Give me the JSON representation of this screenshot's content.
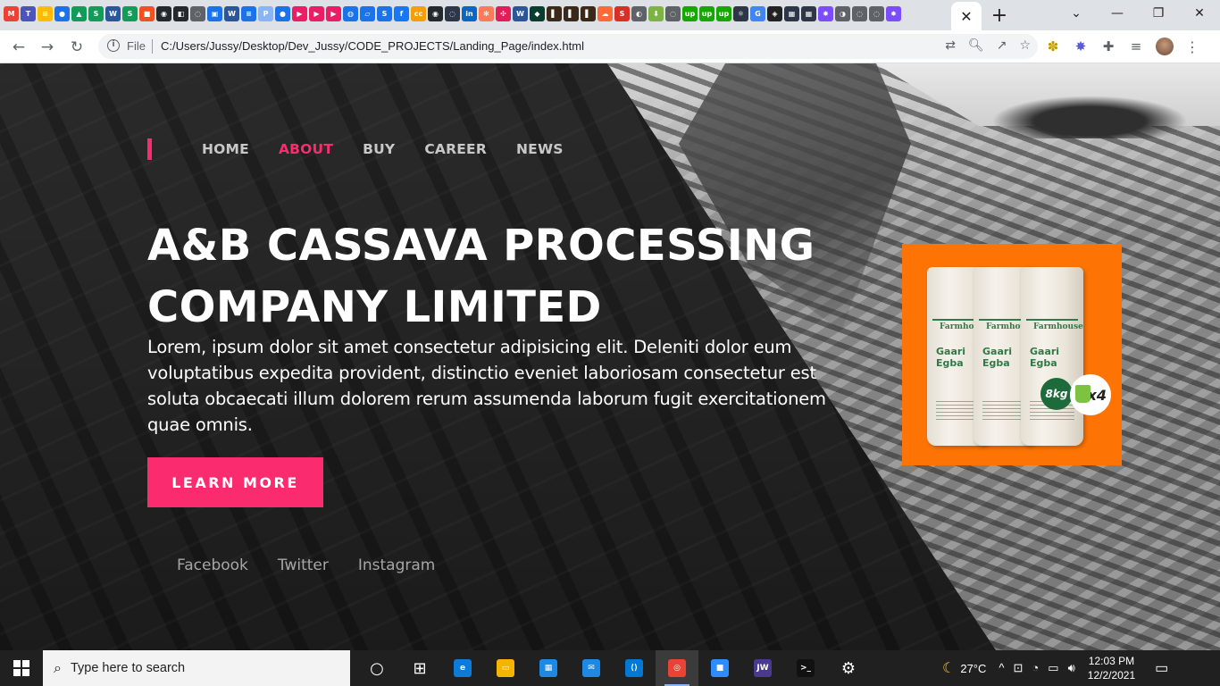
{
  "browser": {
    "active_tab_close": "✕",
    "new_tab": "+",
    "window_controls": [
      "⌄",
      "—",
      "❐",
      "✕"
    ],
    "nav": {
      "back": "←",
      "forward": "→",
      "reload": "↻"
    },
    "address": {
      "scheme_label": "File",
      "url": "C:/Users/Jussy/Desktop/Dev_Jussy/CODE_PROJECTS/Landing_Page/index.html"
    },
    "omnibox_icons": [
      "⇄",
      "🔍︎",
      "↗",
      "☆"
    ],
    "extensions": [
      "✽",
      "✸",
      "✚",
      "≡"
    ],
    "menu": "⋮",
    "favicons": [
      {
        "c": "#ea4335",
        "t": "M"
      },
      {
        "c": "#4b53bc",
        "t": "T"
      },
      {
        "c": "#fbbc04",
        "t": "≡"
      },
      {
        "c": "#1a73e8",
        "t": "●"
      },
      {
        "c": "#0f9d58",
        "t": "▲"
      },
      {
        "c": "#0f9d58",
        "t": "S"
      },
      {
        "c": "#2b579a",
        "t": "W"
      },
      {
        "c": "#0f9d58",
        "t": "S"
      },
      {
        "c": "#f25022",
        "t": "■"
      },
      {
        "c": "#24292e",
        "t": "◉"
      },
      {
        "c": "#24292e",
        "t": "◧"
      },
      {
        "c": "#5f6368",
        "t": "◌"
      },
      {
        "c": "#1a73e8",
        "t": "▣"
      },
      {
        "c": "#2b579a",
        "t": "W"
      },
      {
        "c": "#1a73e8",
        "t": "≡"
      },
      {
        "c": "#8ab4f8",
        "t": "P"
      },
      {
        "c": "#1a73e8",
        "t": "●"
      },
      {
        "c": "#e91e63",
        "t": "▶"
      },
      {
        "c": "#e91e63",
        "t": "▶"
      },
      {
        "c": "#e91e63",
        "t": "▶"
      },
      {
        "c": "#1a73e8",
        "t": "◍"
      },
      {
        "c": "#1a73e8",
        "t": "▱"
      },
      {
        "c": "#1a73e8",
        "t": "S"
      },
      {
        "c": "#1877f2",
        "t": "f"
      },
      {
        "c": "#f59e0b",
        "t": "cc"
      },
      {
        "c": "#24292e",
        "t": "◉"
      },
      {
        "c": "#2d3748",
        "t": "◌"
      },
      {
        "c": "#0a66c2",
        "t": "in"
      },
      {
        "c": "#ff7a59",
        "t": "✻"
      },
      {
        "c": "#e01e5a",
        "t": "✣"
      },
      {
        "c": "#2b579a",
        "t": "W"
      },
      {
        "c": "#0b3d2e",
        "t": "◆"
      },
      {
        "c": "#3b2a1a",
        "t": "▌"
      },
      {
        "c": "#3b2a1a",
        "t": "▌"
      },
      {
        "c": "#3b2a1a",
        "t": "▌"
      },
      {
        "c": "#ff6b35",
        "t": "☁"
      },
      {
        "c": "#d93025",
        "t": "S"
      },
      {
        "c": "#5f6368",
        "t": "◐"
      },
      {
        "c": "#7cb342",
        "t": "⬇"
      },
      {
        "c": "#5f6368",
        "t": "◌"
      },
      {
        "c": "#14a800",
        "t": "up"
      },
      {
        "c": "#14a800",
        "t": "up"
      },
      {
        "c": "#14a800",
        "t": "up"
      },
      {
        "c": "#2d3748",
        "t": "⚛"
      },
      {
        "c": "#4285f4",
        "t": "G"
      },
      {
        "c": "#222",
        "t": "◈"
      },
      {
        "c": "#2d3748",
        "t": "▦"
      },
      {
        "c": "#2d3748",
        "t": "▦"
      },
      {
        "c": "#7c4dff",
        "t": "✸"
      },
      {
        "c": "#5f6368",
        "t": "◑"
      },
      {
        "c": "#5f6368",
        "t": "◌"
      },
      {
        "c": "#5f6368",
        "t": "◌"
      },
      {
        "c": "#7c4dff",
        "t": "✸"
      }
    ]
  },
  "site": {
    "nav": [
      "HOME",
      "ABOUT",
      "BUY",
      "CAREER",
      "NEWS"
    ],
    "nav_active": "ABOUT",
    "hero": {
      "title": "A&B CASSAVA PROCESSING COMPANY LIMITED",
      "text": "Lorem, ipsum dolor sit amet consectetur adipisicing elit. Deleniti dolor eum voluptatibus expedita provident, distinctio eveniet laboriosam consectetur est soluta obcaecati illum dolorem rerum assumenda laborum fugit exercitationem quae omnis.",
      "cta": "LEARN MORE"
    },
    "socials": [
      "Facebook",
      "Twitter",
      "Instagram"
    ],
    "product": {
      "brand": "Farmhouse",
      "name": "Gaari Egba",
      "weight_badge": "8kg",
      "count_badge": "x4"
    },
    "colors": {
      "accent": "#fb2b6f",
      "product_bg": "#fd7405"
    }
  },
  "taskbar": {
    "search_placeholder": "Type here to search",
    "weather": "27°C",
    "time": "12:03 PM",
    "date": "12/2/2021",
    "apps": [
      {
        "name": "task-view",
        "glyph": "○"
      },
      {
        "name": "widgets",
        "glyph": "⊞"
      },
      {
        "name": "edge",
        "glyph": "e",
        "color": "#0f7bd8"
      },
      {
        "name": "file-explorer",
        "glyph": "▭",
        "color": "#f4b400"
      },
      {
        "name": "store",
        "glyph": "▦",
        "color": "#1e88e5"
      },
      {
        "name": "mail",
        "glyph": "✉",
        "color": "#1e88e5"
      },
      {
        "name": "vscode",
        "glyph": "⟨⟩",
        "color": "#0078d4"
      },
      {
        "name": "chrome",
        "glyph": "◎",
        "color": "#ea4335"
      },
      {
        "name": "zoom",
        "glyph": "■",
        "color": "#2d8cff"
      },
      {
        "name": "jw",
        "glyph": "JW",
        "color": "#4a3a8c"
      },
      {
        "name": "terminal",
        "glyph": ">_",
        "color": "#111"
      },
      {
        "name": "settings",
        "glyph": "⚙"
      }
    ],
    "tray_icons": [
      "^",
      "⊡",
      "◔",
      "▭",
      "🔊︎"
    ],
    "notifications": "▭"
  }
}
